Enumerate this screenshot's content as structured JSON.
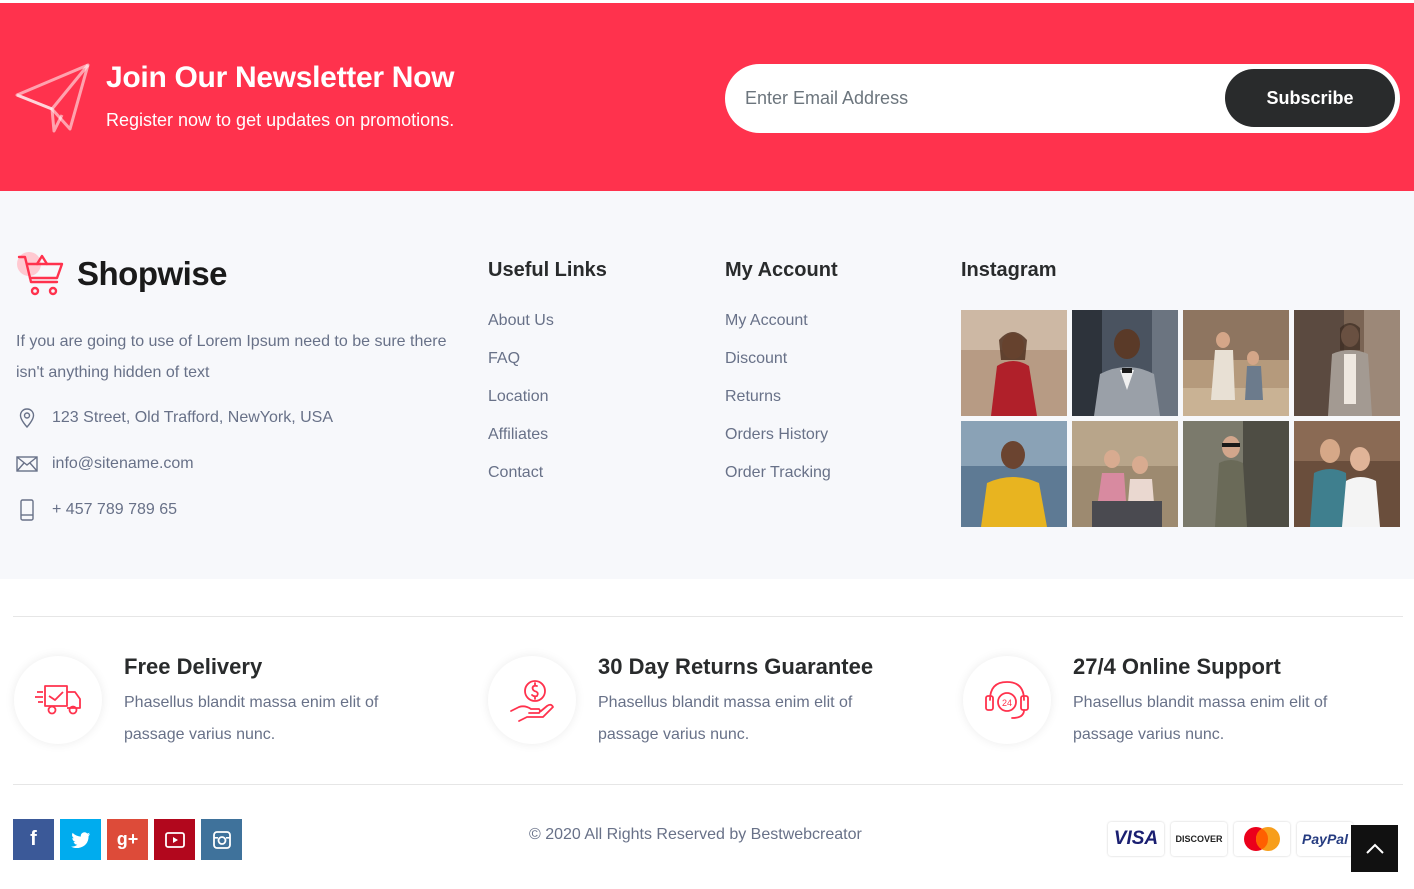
{
  "newsletter": {
    "title": "Join Our Newsletter Now",
    "subtitle": "Register now to get updates on promotions.",
    "email_placeholder": "Enter Email Address",
    "subscribe_label": "Subscribe",
    "icon": "paper-plane-icon"
  },
  "brand": {
    "name": "Shopwise",
    "icon": "shopping-cart-icon",
    "description": "If you are going to use of Lorem Ipsum need to be sure there isn't anything hidden of text"
  },
  "contact": {
    "address": "123 Street, Old Trafford, NewYork, USA",
    "email": "info@sitename.com",
    "phone": "+ 457 789 789 65"
  },
  "useful_links": {
    "title": "Useful Links",
    "items": [
      "About Us",
      "FAQ",
      "Location",
      "Affiliates",
      "Contact"
    ]
  },
  "my_account": {
    "title": "My Account",
    "items": [
      "My Account",
      "Discount",
      "Returns",
      "Orders History",
      "Order Tracking"
    ]
  },
  "instagram": {
    "title": "Instagram"
  },
  "features": [
    {
      "title": "Free Delivery",
      "text": "Phasellus blandit massa enim elit of passage varius nunc.",
      "icon": "delivery-truck-icon"
    },
    {
      "title": "30 Day Returns Guarantee",
      "text": "Phasellus blandit massa enim elit of passage varius nunc.",
      "icon": "money-hand-icon"
    },
    {
      "title": "27/4 Online Support",
      "text": "Phasellus blandit massa enim elit of passage varius nunc.",
      "icon": "headset-24-icon"
    }
  ],
  "social": {
    "facebook": "f",
    "twitter": "t",
    "googleplus": "g+"
  },
  "copyright": "© 2020 All Rights Reserved by Bestwebcreator",
  "payments": {
    "visa": "VISA",
    "discover": "DISCOVER",
    "paypal": "PayPal"
  },
  "colors": {
    "accent": "#ff324d",
    "dark": "#292b2c",
    "muted": "#687188",
    "footer_bg": "#f7f8fb"
  }
}
